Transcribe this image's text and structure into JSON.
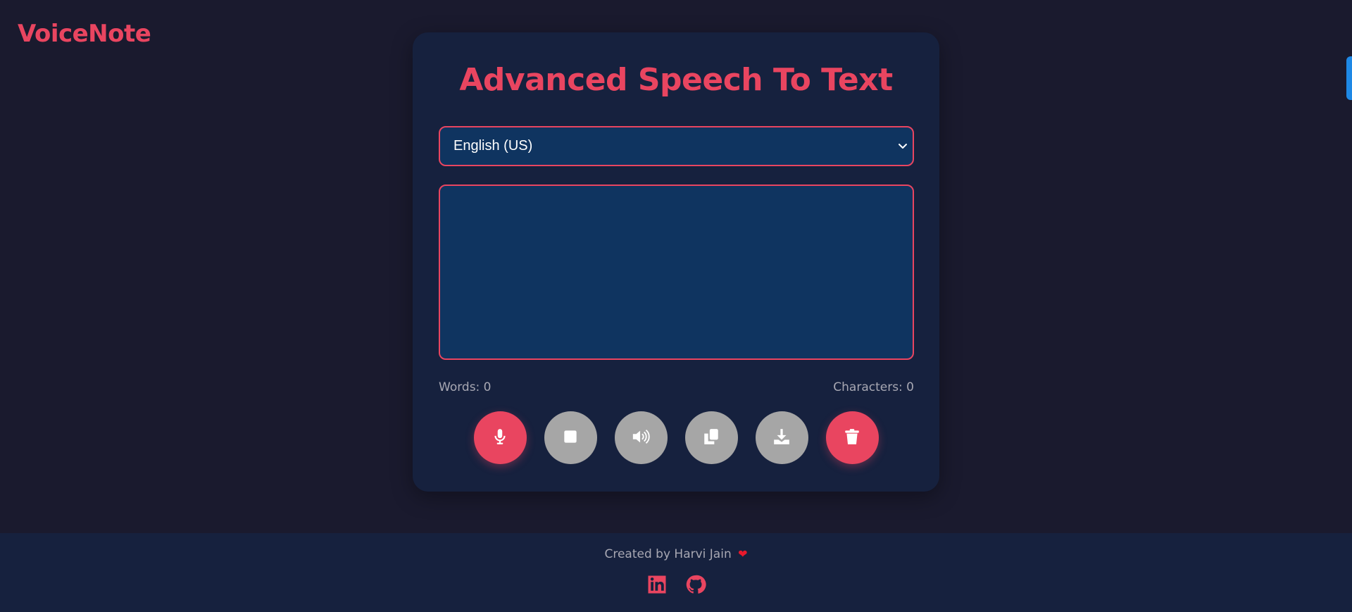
{
  "app": {
    "logo": "VoiceNote"
  },
  "main": {
    "title": "Advanced Speech To Text",
    "language": {
      "selected": "English (US)"
    },
    "transcript": {
      "value": "",
      "placeholder": ""
    },
    "stats": {
      "words": "Words: 0",
      "characters": "Characters: 0"
    }
  },
  "controls": [
    {
      "name": "start-recording-button",
      "icon": "microphone-icon",
      "style": "accent"
    },
    {
      "name": "stop-button",
      "icon": "stop-icon",
      "style": "muted"
    },
    {
      "name": "speak-button",
      "icon": "speaker-icon",
      "style": "muted"
    },
    {
      "name": "copy-button",
      "icon": "copy-icon",
      "style": "muted"
    },
    {
      "name": "download-button",
      "icon": "download-icon",
      "style": "muted"
    },
    {
      "name": "clear-button",
      "icon": "trash-icon",
      "style": "accent"
    }
  ],
  "footer": {
    "credit": "Created by Harvi Jain",
    "heart": "❤",
    "socials": [
      {
        "name": "linkedin-link",
        "icon": "linkedin-icon"
      },
      {
        "name": "github-link",
        "icon": "github-icon"
      }
    ]
  },
  "colors": {
    "background": "#1a1a2e",
    "card": "#16213e",
    "input": "#0f3460",
    "accent": "#e94560",
    "muted_button": "#a6a6a6",
    "text_muted": "#a8a8b3"
  }
}
